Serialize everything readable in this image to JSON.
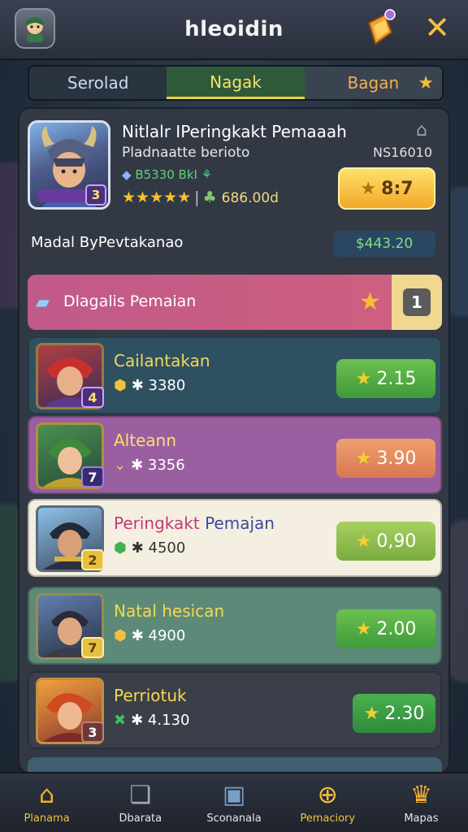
{
  "header": {
    "title": "hleoidin",
    "close_icon": "close-icon",
    "gift_icon": "gift-icon"
  },
  "tabs": [
    {
      "label": "Serolad",
      "active": false
    },
    {
      "label": "Nagak",
      "active": true
    },
    {
      "label": "Bagan",
      "active": false
    }
  ],
  "profile": {
    "name": "Nitlalr IPeringkakt Pemaaah",
    "subtitle": "Pladnaatte berioto",
    "code": "NS16010",
    "stat": "B5330 BkI",
    "stars": "★★★★★",
    "coins": "686.00d",
    "level": "3",
    "score": "8:7"
  },
  "modal": {
    "label": "Madal ByPevtakanao",
    "value": "$443.20"
  },
  "banner": {
    "text": "Dlagalis Pemaian",
    "rank": "1"
  },
  "entries": [
    {
      "name": "Cailantakan",
      "meta": "3380",
      "level": "4",
      "button": "2.15",
      "rank_marker": "gold"
    },
    {
      "name": "Alteann",
      "meta": "3356",
      "level": "7",
      "button": "3.90",
      "rank_marker": "gold"
    },
    {
      "name_a": "Peringkakt",
      "name_b": "Pemajan",
      "meta": "4500",
      "level": "2",
      "button": "0,90",
      "rank_marker": "green"
    },
    {
      "name": "Natal hesican",
      "meta": "4900",
      "level": "7",
      "button": "2.00",
      "rank_marker": "gold"
    },
    {
      "name": "Perriotuk",
      "meta": "4.130",
      "level": "3",
      "button": "2.30",
      "rank_marker": "green"
    }
  ],
  "nav": [
    {
      "label": "Planama",
      "icon": "home-icon",
      "active": true
    },
    {
      "label": "Dbarata",
      "icon": "cards-icon",
      "active": false
    },
    {
      "label": "Sconanala",
      "icon": "robot-icon",
      "active": false
    },
    {
      "label": "Pemaciory",
      "icon": "download-icon",
      "active": false
    },
    {
      "label": "Mapas",
      "icon": "trophy-icon",
      "active": false
    }
  ],
  "colors": {
    "accent_gold": "#f5c030",
    "row1": "#2f5060",
    "row2": "#9a5fa0",
    "row3": "#f4efe0",
    "row4": "#5d8a78",
    "row5": "#3a3f4a"
  }
}
